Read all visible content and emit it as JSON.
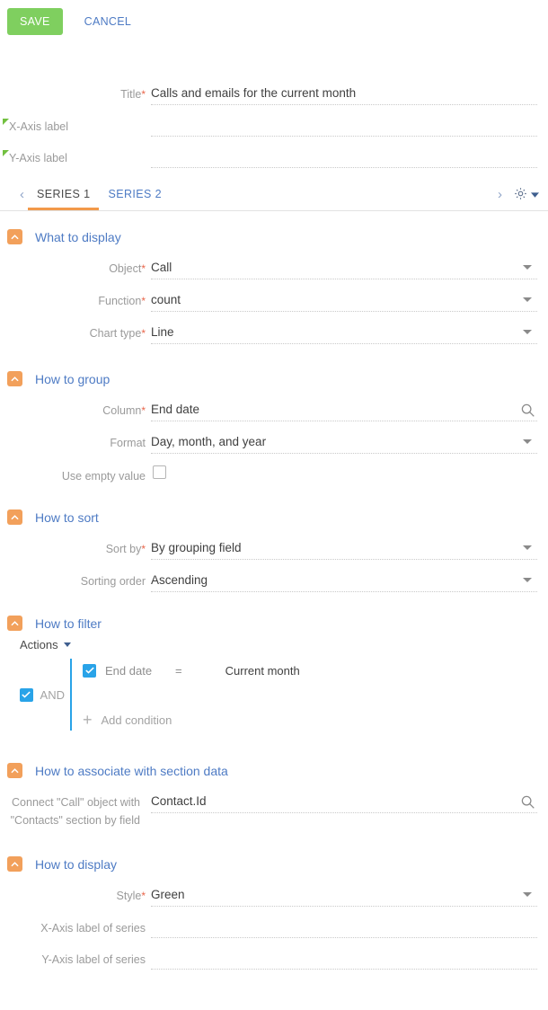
{
  "toolbar": {
    "save_label": "SAVE",
    "cancel_label": "CANCEL"
  },
  "header_fields": {
    "title": {
      "label": "Title",
      "required": true,
      "value": "Calls and emails for the current month"
    },
    "x_axis_label": {
      "label": "X-Axis label",
      "value": "",
      "localized": true
    },
    "y_axis_label": {
      "label": "Y-Axis label",
      "value": "",
      "localized": true
    }
  },
  "tabs": {
    "prev_arrow": "‹",
    "next_arrow": "›",
    "items": [
      {
        "label": "SERIES 1",
        "active": true
      },
      {
        "label": "SERIES 2",
        "active": false
      }
    ]
  },
  "sections": {
    "what_to_display": {
      "title": "What to display",
      "object": {
        "label": "Object",
        "value": "Call"
      },
      "function": {
        "label": "Function",
        "value": "count"
      },
      "chart_type": {
        "label": "Chart type",
        "value": "Line"
      }
    },
    "how_to_group": {
      "title": "How to group",
      "column": {
        "label": "Column",
        "value": "End date"
      },
      "format": {
        "label": "Format",
        "value": "Day, month, and year"
      },
      "use_empty_value": {
        "label": "Use empty value",
        "checked": false
      }
    },
    "how_to_sort": {
      "title": "How to sort",
      "sort_by": {
        "label": "Sort by",
        "value": "By grouping field"
      },
      "sorting_order": {
        "label": "Sorting order",
        "value": "Ascending"
      }
    },
    "how_to_filter": {
      "title": "How to filter",
      "actions_label": "Actions",
      "logical_operator": {
        "label": "AND",
        "checked": true
      },
      "conditions": [
        {
          "enabled": true,
          "field": "End date",
          "operator": "=",
          "value": "Current month"
        }
      ],
      "add_condition_label": "Add condition"
    },
    "how_to_associate": {
      "title": "How to associate with section data",
      "connect_field": {
        "label_line1": "Connect \"Call\" object with",
        "label_line2": "\"Contacts\" section by field",
        "value": "Contact.Id"
      }
    },
    "how_to_display": {
      "title": "How to display",
      "style": {
        "label": "Style",
        "value": "Green"
      },
      "x_axis_label_of_series": {
        "label": "X-Axis label of series",
        "value": ""
      },
      "y_axis_label_of_series": {
        "label": "Y-Axis label of series",
        "value": ""
      }
    }
  },
  "colors": {
    "save_green": "#7FCF5F",
    "link_blue": "#4E7BC4",
    "accent_orange": "#F2A05B",
    "tab_underline": "#F2994A",
    "checkbox_blue": "#29A3E8",
    "required_red": "#E8664B",
    "localization_green": "#72C040"
  }
}
